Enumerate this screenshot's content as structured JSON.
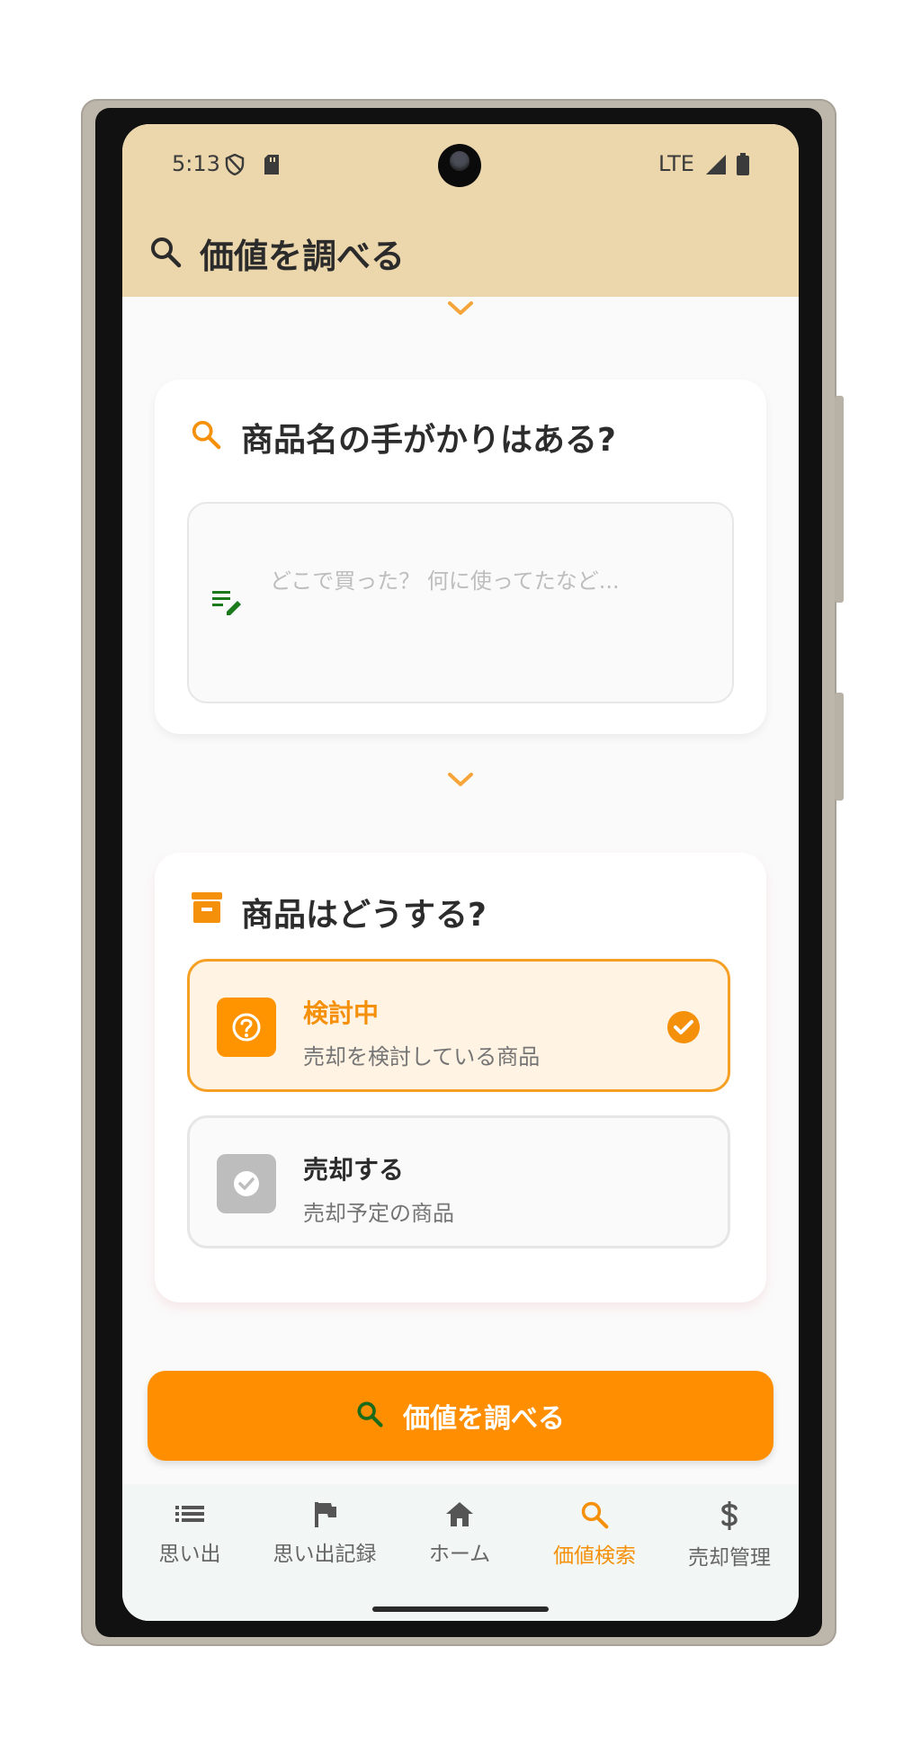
{
  "status_bar": {
    "time": "5:13",
    "network": "LTE"
  },
  "header": {
    "title": "価値を調べる",
    "icon": "search-icon"
  },
  "hint_card": {
    "title": "商品名の手がかりはある?",
    "icon": "search-icon",
    "memo_placeholder": "どこで買った？ 何に使ってたなど..."
  },
  "status_card": {
    "title": "商品はどうする?",
    "icon": "archive-icon",
    "options": [
      {
        "title": "検討中",
        "subtitle": "売却を検討している商品",
        "selected": true,
        "icon": "help-circle-icon"
      },
      {
        "title": "売却する",
        "subtitle": "売却予定の商品",
        "selected": false,
        "icon": "check-circle-icon"
      }
    ]
  },
  "cta": {
    "label": "価値を調べる",
    "icon": "search-icon"
  },
  "bottom_nav": {
    "items": [
      {
        "label": "思い出",
        "icon": "list-icon",
        "active": false
      },
      {
        "label": "思い出記録",
        "icon": "flag-icon",
        "active": false
      },
      {
        "label": "ホーム",
        "icon": "home-icon",
        "active": false
      },
      {
        "label": "価値検索",
        "icon": "search-icon",
        "active": true
      },
      {
        "label": "売却管理",
        "icon": "dollar-icon",
        "active": false
      }
    ]
  },
  "colors": {
    "accent": "#ff8f00",
    "header_bg": "#ebd7ab",
    "selected_bg": "#fff3e4",
    "memo_icon": "#1b7a1b"
  }
}
